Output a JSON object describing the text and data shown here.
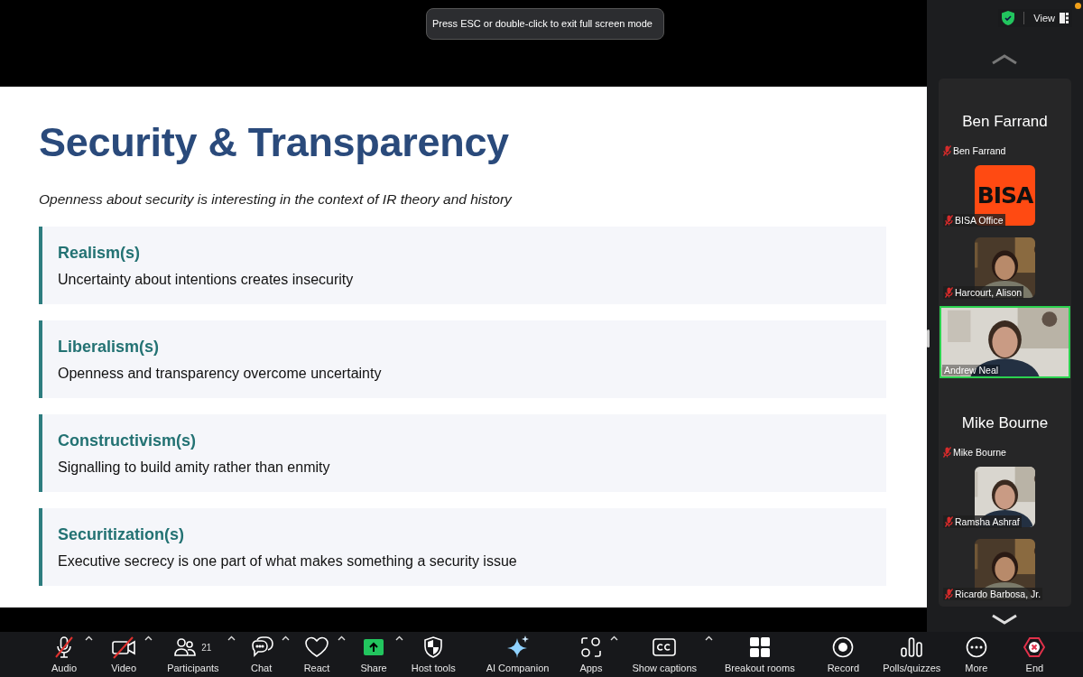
{
  "fullscreen_hint": "Press ESC or double-click to exit full screen mode",
  "view_button": {
    "label": "View"
  },
  "slide": {
    "title": "Security & Transparency",
    "subtitle": "Openness about security is interesting in the context of IR theory and history",
    "cards": [
      {
        "heading": "Realism(s)",
        "body": "Uncertainty about intentions creates insecurity"
      },
      {
        "heading": "Liberalism(s)",
        "body": "Openness and transparency overcome uncertainty"
      },
      {
        "heading": "Constructivism(s)",
        "body": "Signalling to build amity rather than enmity"
      },
      {
        "heading": "Securitization(s)",
        "body": "Executive secrecy is one part of what makes something a security issue"
      }
    ]
  },
  "participants": [
    {
      "kind": "name",
      "display": "Ben Farrand",
      "label": "Ben Farrand",
      "muted": true
    },
    {
      "kind": "logo",
      "logo_text": "BISA",
      "label": "BISA Office",
      "muted": true
    },
    {
      "kind": "video",
      "label": "Harcourt, Alison",
      "muted": true
    },
    {
      "kind": "speaker",
      "label": "Andrew Neal",
      "muted": false
    },
    {
      "kind": "name",
      "display": "Mike Bourne",
      "label": "Mike Bourne",
      "muted": true
    },
    {
      "kind": "video",
      "label": "Ramsha Ashraf",
      "muted": true
    },
    {
      "kind": "video",
      "label": "Ricardo Barbosa, Jr.",
      "muted": true
    }
  ],
  "toolbar": [
    {
      "kind": "audio",
      "label": "Audio",
      "caret": true,
      "off": true
    },
    {
      "kind": "video",
      "label": "Video",
      "caret": true,
      "off": true
    },
    {
      "kind": "participants",
      "label": "Participants",
      "count": "21",
      "caret": true
    },
    {
      "kind": "chat",
      "label": "Chat",
      "caret": true
    },
    {
      "kind": "react",
      "label": "React",
      "caret": true
    },
    {
      "kind": "share",
      "label": "Share",
      "caret": true
    },
    {
      "kind": "host",
      "label": "Host tools",
      "caret": false
    },
    {
      "kind": "ai",
      "label": "AI Companion",
      "caret": false
    },
    {
      "kind": "apps",
      "label": "Apps",
      "caret": true
    },
    {
      "kind": "captions",
      "label": "Show captions",
      "caret": true
    },
    {
      "kind": "breakout",
      "label": "Breakout rooms",
      "caret": false
    },
    {
      "kind": "record",
      "label": "Record",
      "caret": false
    },
    {
      "kind": "polls",
      "label": "Polls/quizzes",
      "caret": false
    },
    {
      "kind": "more",
      "label": "More",
      "caret": false
    },
    {
      "kind": "end",
      "label": "End",
      "caret": false
    }
  ]
}
